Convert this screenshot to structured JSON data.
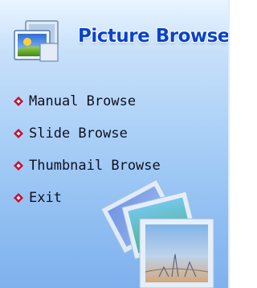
{
  "header": {
    "title": "Picture Browse",
    "icon": "picture-folder-icon"
  },
  "menu": {
    "items": [
      {
        "label": "Manual Browse",
        "icon": "diamond-bullet-icon"
      },
      {
        "label": "Slide Browse",
        "icon": "diamond-bullet-icon"
      },
      {
        "label": "Thumbnail Browse",
        "icon": "diamond-bullet-icon"
      },
      {
        "label": "Exit",
        "icon": "diamond-bullet-icon"
      }
    ]
  },
  "colors": {
    "title": "#0a43c8",
    "bullet": "#c8102e",
    "panel_top": "#e9f4ff",
    "panel_bottom": "#7fb1ee"
  },
  "decoration": "stacked-photos-icon"
}
